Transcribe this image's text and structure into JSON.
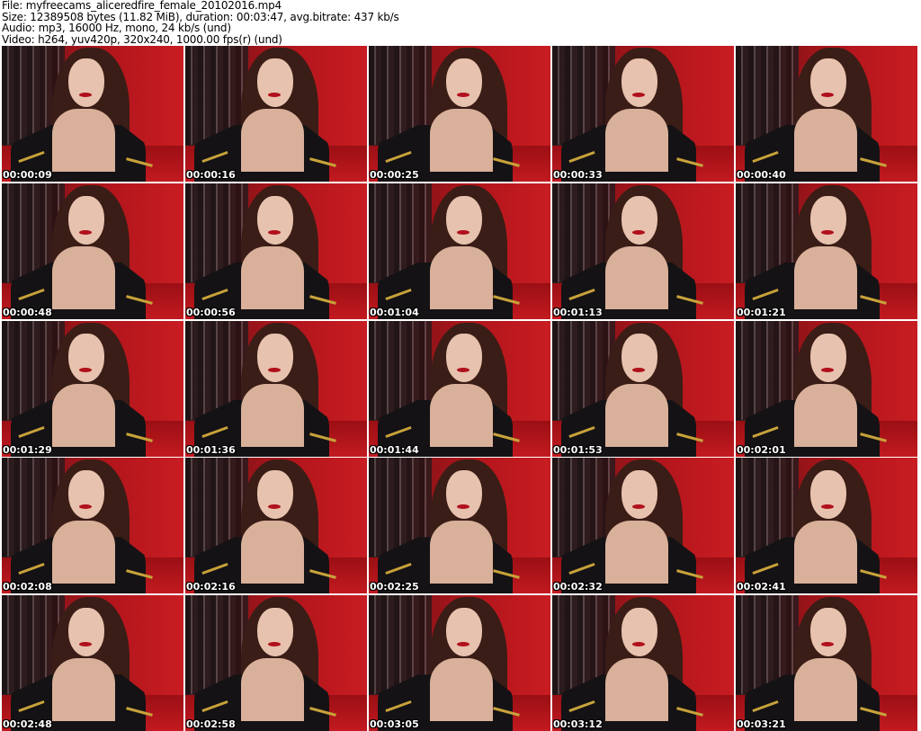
{
  "header": {
    "file": "File: myfreecams_aliceredfire_female_20102016.mp4",
    "size": "Size: 12389508 bytes (11.82 MiB), duration: 00:03:47, avg.bitrate: 437 kb/s",
    "audio": "Audio: mp3, 16000 Hz, mono, 24 kb/s (und)",
    "video": "Video: h264, yuv420p, 320x240, 1000.00 fps(r) (und)"
  },
  "thumbnails": [
    "00:00:09",
    "00:00:16",
    "00:00:25",
    "00:00:33",
    "00:00:40",
    "00:00:48",
    "00:00:56",
    "00:01:04",
    "00:01:13",
    "00:01:21",
    "00:01:29",
    "00:01:36",
    "00:01:44",
    "00:01:53",
    "00:02:01",
    "00:02:08",
    "00:02:16",
    "00:02:25",
    "00:02:32",
    "00:02:41",
    "00:02:48",
    "00:02:58",
    "00:03:05",
    "00:03:12",
    "00:03:21"
  ]
}
